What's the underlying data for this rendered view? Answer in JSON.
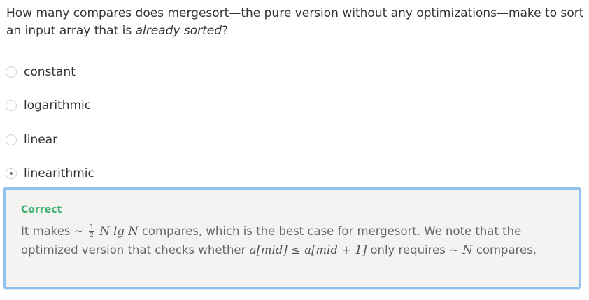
{
  "question": {
    "text_before": "How many compares does mergesort—the pure version without any optimizations—make to sort an input array that is ",
    "text_emphasis": "already sorted",
    "text_after": "?"
  },
  "options": [
    {
      "label": "constant",
      "selected": false
    },
    {
      "label": "logarithmic",
      "selected": false
    },
    {
      "label": "linear",
      "selected": false
    },
    {
      "label": "linearithmic",
      "selected": true
    }
  ],
  "feedback": {
    "status": "Correct",
    "text_1": "It makes",
    "math_tilde_1": "~",
    "math_frac_num": "1",
    "math_frac_den": "2",
    "math_expr_1": "N lg N",
    "text_2": "compares, which is the best case for mergesort. We note that the optimized version that checks whether",
    "math_expr_2": "a[mid] ≤ a[mid + 1]",
    "text_3": "only requires",
    "math_tilde_2": "~",
    "math_expr_3": "N",
    "text_4": "compares.",
    "colors": {
      "status": "#3fae6f",
      "border": "#8fc0ee",
      "background": "#f3f3f1"
    }
  },
  "icons": {
    "radio_unchecked": "radio-unchecked-icon",
    "radio_checked": "radio-checked-icon"
  }
}
